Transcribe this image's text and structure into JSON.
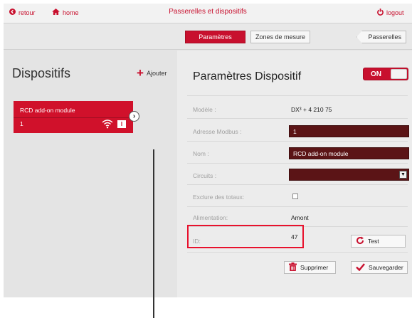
{
  "topbar": {
    "back_label": "retour",
    "home_label": "home",
    "title": "Passerelles et dispositifs",
    "logout_label": "logout"
  },
  "tabs": {
    "params": "Paramètres",
    "zones": "Zones de mesure",
    "gateways": "Passerelles"
  },
  "left": {
    "title": "Dispositifs",
    "add_label": "Ajouter",
    "device": {
      "name": "RCD add-on module",
      "number": "1",
      "badge": "I"
    }
  },
  "right": {
    "title": "Paramètres Dispositif",
    "toggle": "ON",
    "fields": {
      "model_label": "Modèle :",
      "model_value": "DX³ + 4 210 75",
      "modbus_label": "Adresse Modbus :",
      "modbus_value": "1",
      "name_label": "Nom :",
      "name_value": "RCD add-on module",
      "circuits_label": "Circuits :",
      "circuits_value": "",
      "exclude_label": "Exclure des totaux:",
      "power_label": "Alimentation:",
      "power_value": "Amont",
      "id_label": "ID:",
      "id_value": "47"
    },
    "buttons": {
      "test": "Test",
      "delete": "Supprimer",
      "save": "Sauvegarder"
    }
  },
  "colors": {
    "accent": "#c8102e",
    "field_bg": "#5b1416",
    "highlight_box": "#e8112d"
  }
}
